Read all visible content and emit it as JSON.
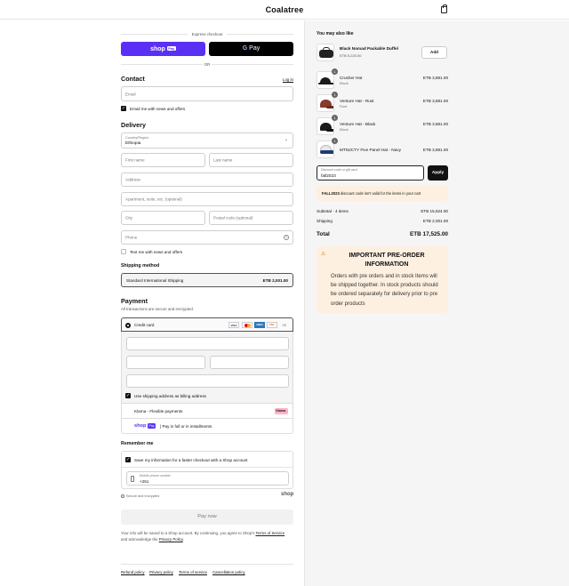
{
  "header": {
    "brand": "Coalatree"
  },
  "express": {
    "title": "Express checkout",
    "shop_pay": "shop",
    "shop_pay_badge": "Pay",
    "gpay_g": "G",
    "gpay_text": "Pay",
    "or": "OR"
  },
  "contact": {
    "title": "Contact",
    "login": "Log in",
    "email_placeholder": "Email",
    "news_label": "Email me with news and offers"
  },
  "delivery": {
    "title": "Delivery",
    "country_label": "Country/Region",
    "country_value": "Ethiopia",
    "first_name": "First name",
    "last_name": "Last name",
    "address": "Address",
    "apartment": "Apartment, suite, etc. (optional)",
    "city": "City",
    "postal": "Postal code (optional)",
    "phone": "Phone",
    "text_label": "Text me with news and offers"
  },
  "shipping": {
    "title": "Shipping method",
    "method": "Standard International Shipping",
    "price": "ETB 2,001.00"
  },
  "payment": {
    "title": "Payment",
    "subtitle": "All transactions are secure and encrypted.",
    "credit_card": "Credit card",
    "card_brands": [
      "VISA",
      "MC",
      "AMEX",
      "DISC"
    ],
    "more_cards": "+3",
    "billing_label": "Use shipping address as billing address",
    "klarna_label": "Klarna - Flexible payments",
    "klarna_badge": "Klarna.",
    "shoppay_logo": "shop",
    "shoppay_badge": "Pay",
    "shoppay_label": "| Pay in full or in installments"
  },
  "remember": {
    "title": "Remember me",
    "save_label": "Save my information for a faster checkout with a Shop account",
    "phone_label": "Mobile phone number",
    "phone_value": "+251",
    "secure": "Secure and encrypted",
    "shop_logo": "shop"
  },
  "pay_now": "Pay now",
  "disclaimer": {
    "text1": "Your info will be saved to a Shop account. By continuing, you agree to Shop's",
    "terms": "Terms of Service",
    "text2": "and acknowledge the",
    "privacy": "Privacy Policy",
    "end": "."
  },
  "footer_links": [
    "Refund policy",
    "Privacy policy",
    "Terms of service",
    "Cancellation policy"
  ],
  "sidebar": {
    "also_like_title": "You may also like",
    "upsell": {
      "name": "Black Nomad Packable Duffel",
      "price": "ETB 5,220.00",
      "add": "Add"
    },
    "items": [
      {
        "qty": "1",
        "name": "Crusher Hat",
        "variant": "Black",
        "price": "ETB 3,881.00",
        "color": "#1b1b1b"
      },
      {
        "qty": "1",
        "name": "Venture Hat - Rust",
        "variant": "Rust",
        "price": "ETB 3,881.00",
        "color": "#8a3a2a"
      },
      {
        "qty": "1",
        "name": "Venture Hat - Black",
        "variant": "Black",
        "price": "ETB 3,881.00",
        "color": "#1b1b1b"
      },
      {
        "qty": "1",
        "name": "MTN2CTY Five Panel Hat - Navy",
        "variant": "",
        "price": "ETB 3,881.00",
        "color": "#1f3c6e"
      }
    ],
    "discount": {
      "label": "Discount code or gift card",
      "value": "fall2023",
      "apply": "Apply"
    },
    "discount_error": {
      "code": "FALL2023",
      "text": "discount code isn't valid for the items in your cart"
    },
    "subtotal_label": "Subtotal · 4 items",
    "subtotal": "ETB 15,524.00",
    "shipping_label": "Shipping",
    "shipping": "ETB 2,001.00",
    "total_label": "Total",
    "total": "ETB 17,525.00",
    "notice": {
      "title": "IMPORTANT PRE-ORDER INFORMATION",
      "body": "Orders with pre orders and in stock Items will be shipped together. In stock products should be ordered separately for delivery prior to pre order products"
    }
  },
  "colors": {
    "shop_purple": "#5a31f4",
    "notice_bg": "#fdf0e1",
    "error_bg": "#fdf0e1",
    "amex_blue": "#2e77bc"
  }
}
